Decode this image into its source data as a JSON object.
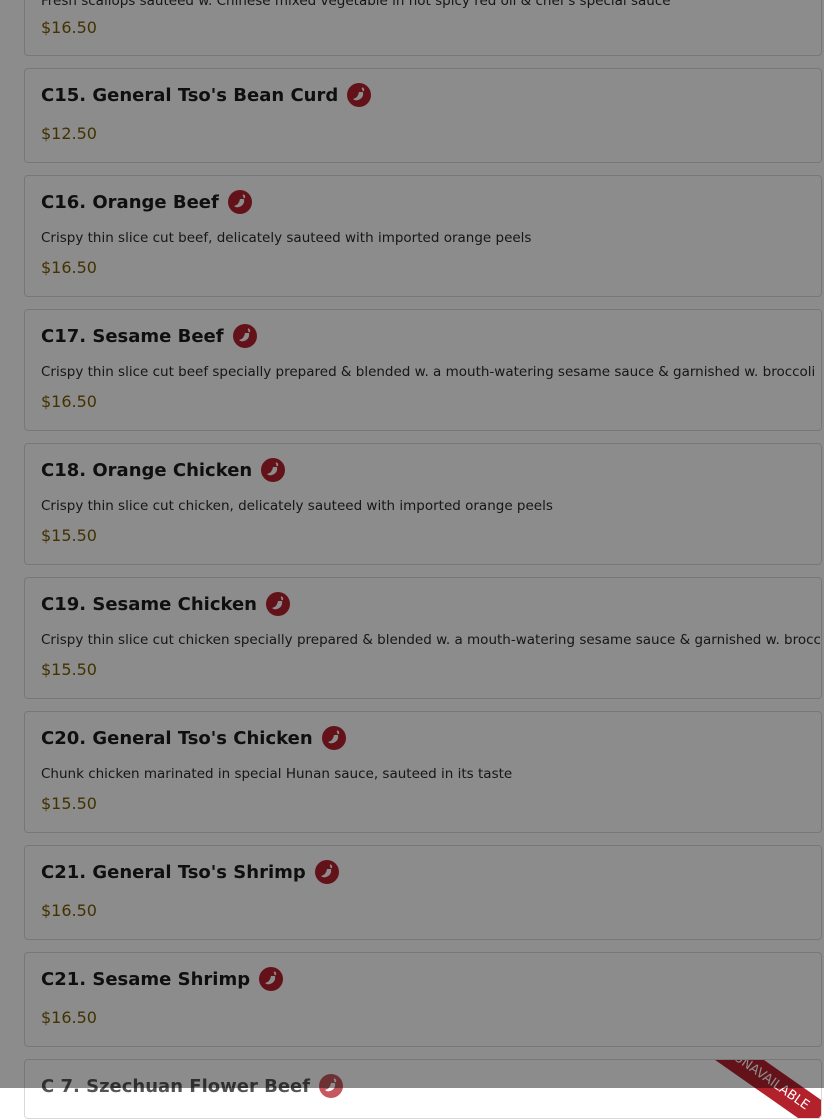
{
  "top_partial": {
    "desc": "Fresh scallops sauteed w. Chinese mixed vegetable in hot spicy red oil & chef's special sauce",
    "price": "$16.50"
  },
  "items": [
    {
      "title": "C15. General Tso's Bean Curd",
      "desc": "",
      "price": "$12.50",
      "spicy": true
    },
    {
      "title": "C16. Orange Beef",
      "desc": "Crispy thin slice cut beef, delicately sauteed with imported orange peels",
      "price": "$16.50",
      "spicy": true
    },
    {
      "title": "C17. Sesame Beef",
      "desc": "Crispy thin slice cut beef specially prepared & blended w. a mouth-watering sesame sauce & garnished w. broccoli",
      "price": "$16.50",
      "spicy": true
    },
    {
      "title": "C18. Orange Chicken",
      "desc": "Crispy thin slice cut chicken, delicately sauteed with imported orange peels",
      "price": "$15.50",
      "spicy": true
    },
    {
      "title": "C19. Sesame Chicken",
      "desc": "Crispy thin slice cut chicken specially prepared & blended w. a mouth-watering sesame sauce & garnished w. broccoli",
      "price": "$15.50",
      "spicy": true
    },
    {
      "title": "C20. General Tso's Chicken",
      "desc": "Chunk chicken marinated in special Hunan sauce, sauteed in its taste",
      "price": "$15.50",
      "spicy": true
    },
    {
      "title": "C21. General Tso's Shrimp",
      "desc": "",
      "price": "$16.50",
      "spicy": true
    },
    {
      "title": "C21. Sesame Shrimp",
      "desc": "",
      "price": "$16.50",
      "spicy": true
    }
  ],
  "bottom_partial": {
    "title": "C 7. Szechuan Flower Beef",
    "ribbon": "UNAVAILABLE"
  },
  "colors": {
    "chili": "#b3222c",
    "price": "#7a5a00",
    "overlay": "rgba(0,0,0,0.45)"
  },
  "icons": {
    "spicy": "chili-pepper-icon"
  }
}
